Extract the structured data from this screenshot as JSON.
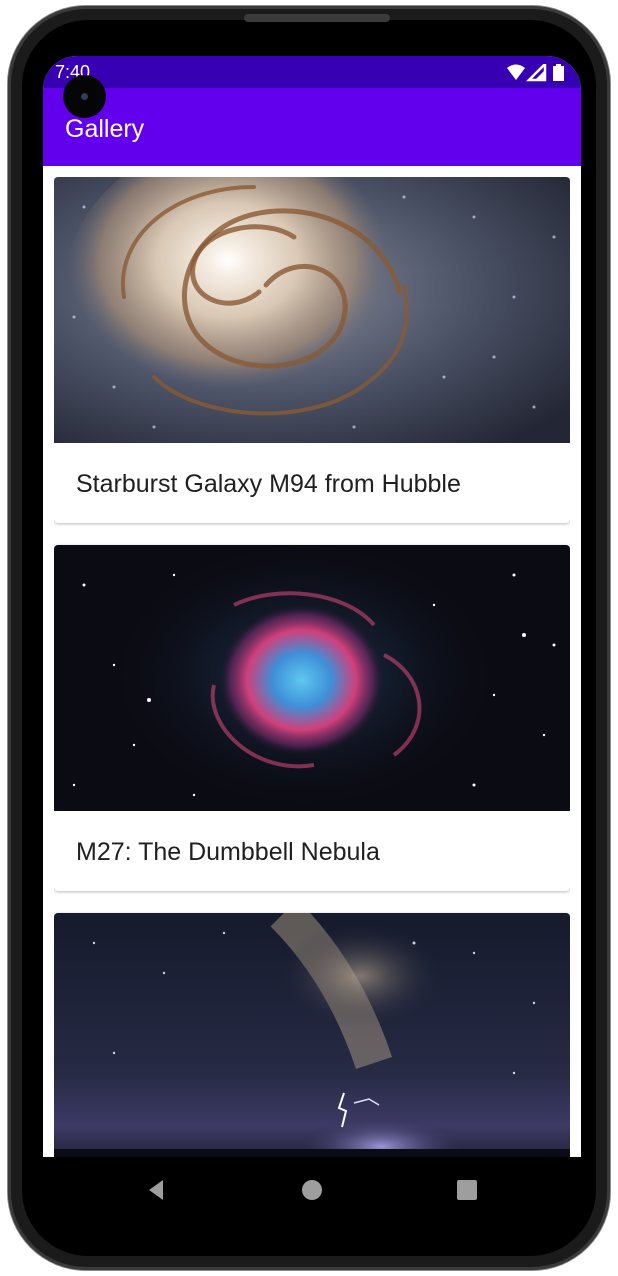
{
  "status_bar": {
    "time": "7:40",
    "icons": [
      "wifi-icon",
      "signal-icon",
      "battery-icon"
    ],
    "color": "#3700b3"
  },
  "app_bar": {
    "title": "Gallery",
    "color": "#6200ee"
  },
  "gallery": {
    "items": [
      {
        "title": "Starburst Galaxy M94 from Hubble",
        "image": "spiral-galaxy-image"
      },
      {
        "title": "M27: The Dumbbell Nebula",
        "image": "nebula-image"
      },
      {
        "title": "",
        "image": "milky-way-lightning-image"
      }
    ]
  },
  "navigation": {
    "buttons": [
      "back-icon",
      "home-icon",
      "recents-icon"
    ]
  }
}
